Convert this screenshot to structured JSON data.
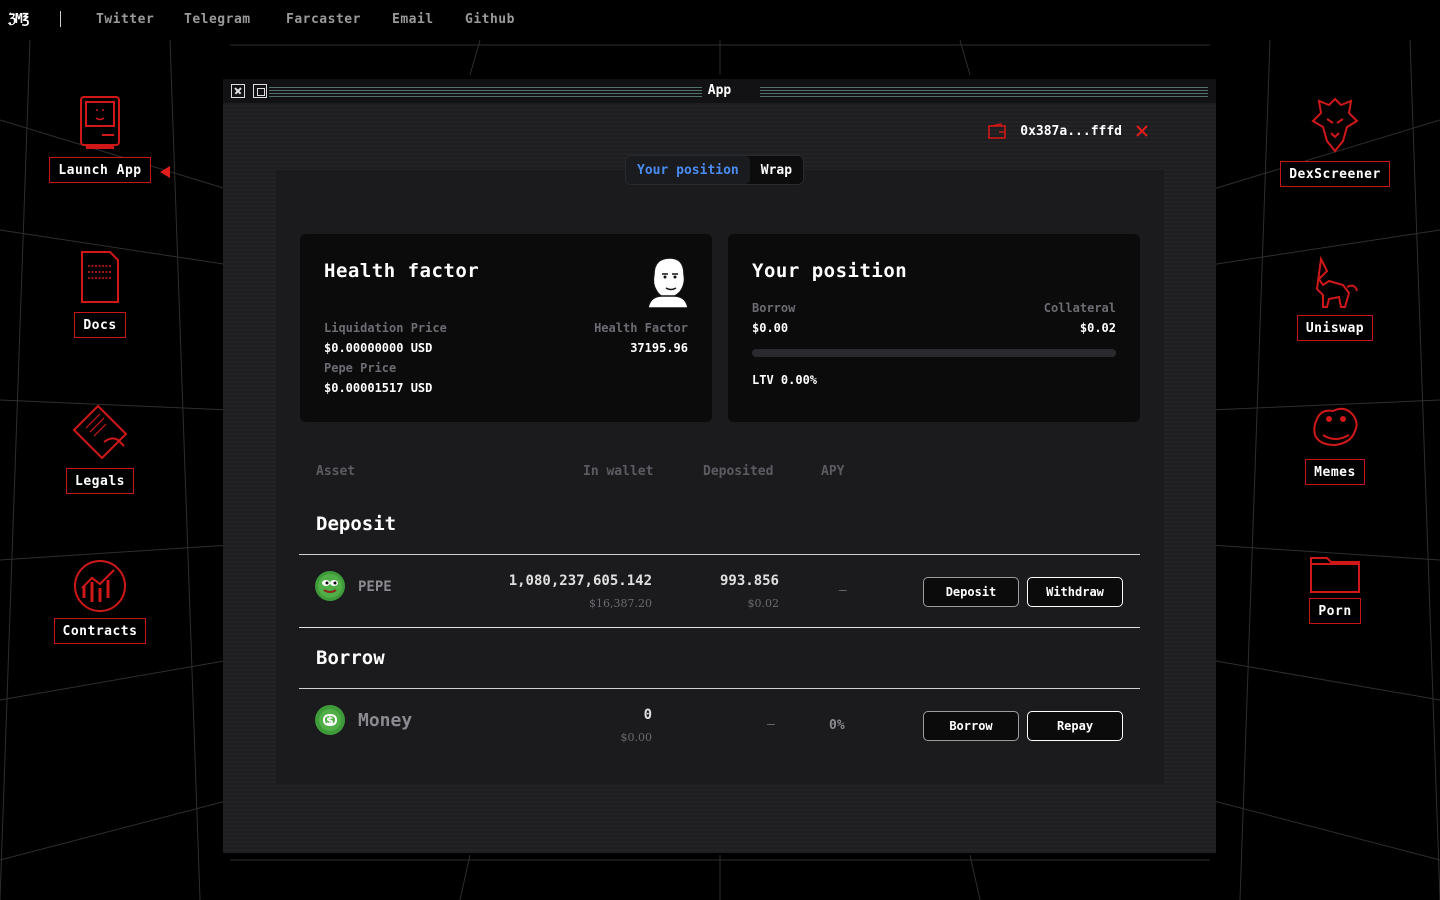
{
  "nav": {
    "logo": "ℨM℥",
    "links": [
      "Twitter",
      "Telegram",
      "Farcaster",
      "Email",
      "Github"
    ]
  },
  "desktop": {
    "left": [
      "Launch App",
      "Docs",
      "Legals",
      "Contracts"
    ],
    "right": [
      "DexScreener",
      "Uniswap",
      "Memes",
      "Porn"
    ]
  },
  "window": {
    "title": "App",
    "wallet_address": "0x387a...fffd"
  },
  "tabs": [
    "Your position",
    "Wrap"
  ],
  "health_card": {
    "title": "Health factor",
    "liq_label": "Liquidation Price",
    "liq_value": "$0.00000000 USD",
    "pepe_label": "Pepe Price",
    "pepe_value": "$0.00001517 USD",
    "hf_label": "Health Factor",
    "hf_value": "37195.96"
  },
  "position_card": {
    "title": "Your position",
    "borrow_label": "Borrow",
    "borrow_value": "$0.00",
    "collateral_label": "Collateral",
    "collateral_value": "$0.02",
    "ltv_fraction": 0,
    "ltv_text": "LTV 0.00%"
  },
  "table": {
    "headers": [
      "Asset",
      "In wallet",
      "Deposited",
      "APY"
    ],
    "deposit_section": "Deposit",
    "borrow_section": "Borrow",
    "deposit_row": {
      "asset": "PEPE",
      "wallet": "1,080,237,605.142",
      "wallet_usd": "$16,387.20",
      "deposited": "993.856",
      "deposited_usd": "$0.02",
      "apy": "–",
      "btn1": "Deposit",
      "btn2": "Withdraw"
    },
    "borrow_row": {
      "asset": "Money",
      "wallet": "0",
      "wallet_usd": "$0.00",
      "deposited": "–",
      "apy": "0%",
      "btn1": "Borrow",
      "btn2": "Repay"
    }
  },
  "colors": {
    "accent_red": "#c81414",
    "tab_active": "#4a8cf0",
    "pepe_green": "#3f9a3a"
  }
}
